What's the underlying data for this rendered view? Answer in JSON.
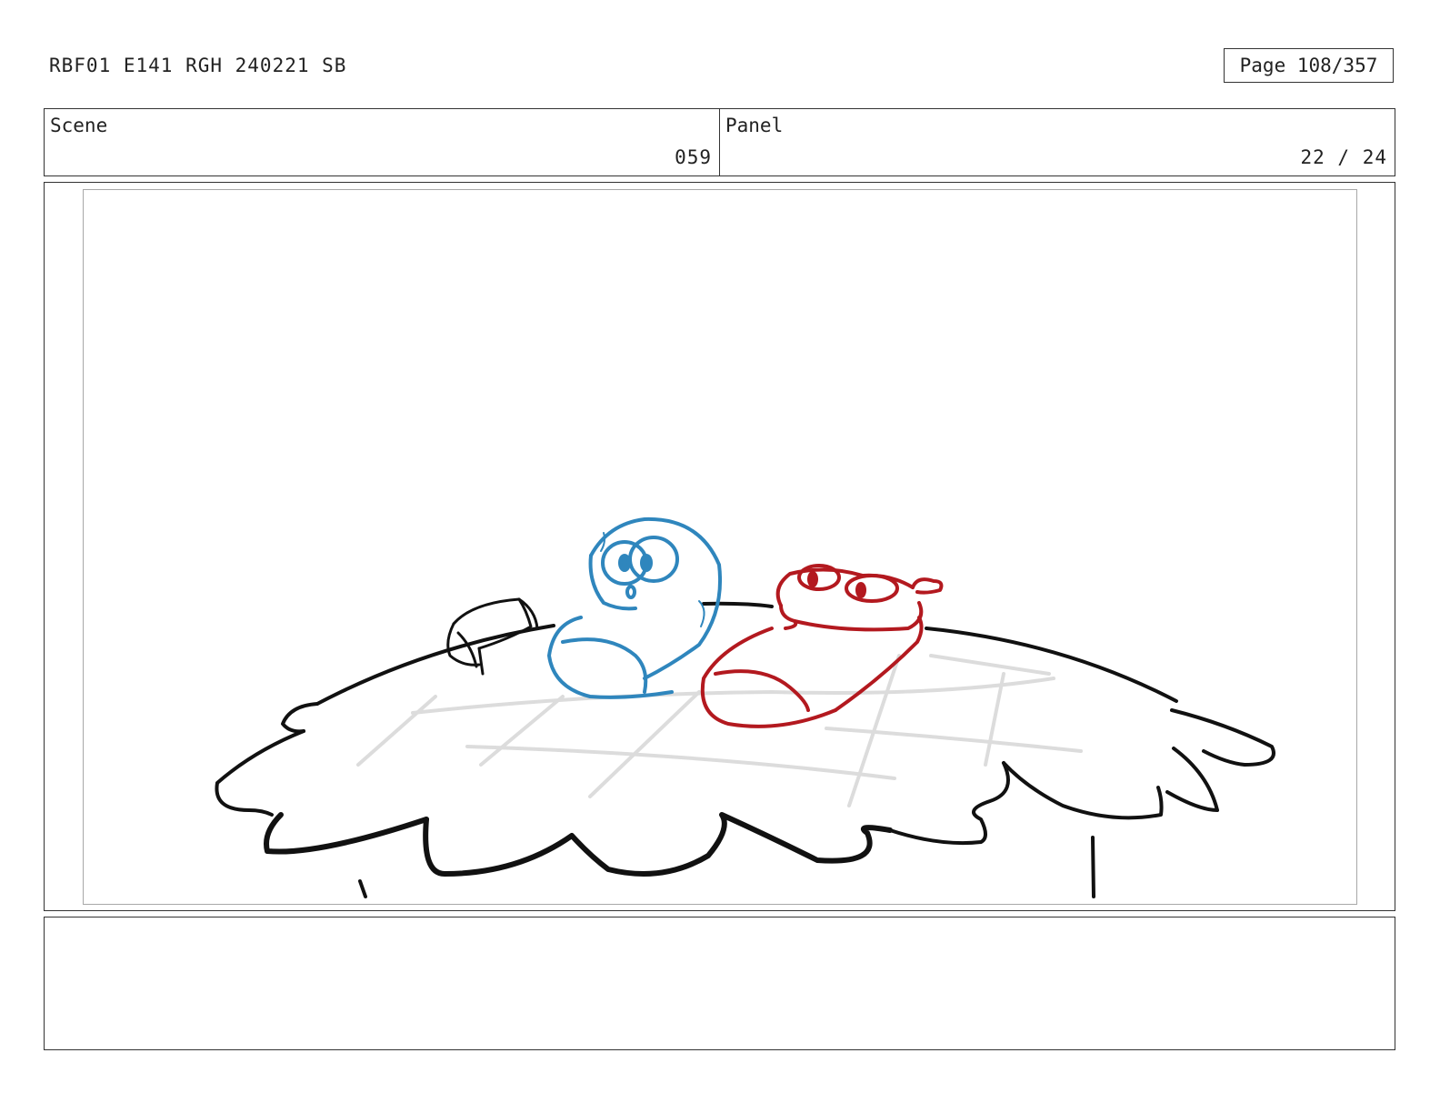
{
  "header": {
    "title": "RBF01 E141 RGH 240221 SB",
    "page_label": "Page 108/357"
  },
  "info": {
    "scene_label": "Scene",
    "scene_value": "059",
    "panel_label": "Panel",
    "panel_value": "22 / 24"
  },
  "panel": {
    "characters": [
      {
        "name": "blue-character",
        "color": "#2f86bd"
      },
      {
        "name": "red-character",
        "color": "#b3191f"
      }
    ],
    "line_color": "#111111",
    "grid_color": "#dcdcdc"
  },
  "notes": {
    "text": ""
  }
}
